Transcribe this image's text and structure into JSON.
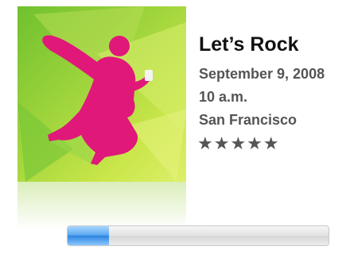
{
  "event": {
    "title": "Let’s Rock",
    "date": "September 9, 2008",
    "time": "10 a.m.",
    "location": "San Francisco",
    "rating_stars": "★★★★★",
    "rating": 5
  },
  "artwork": {
    "description_icon": "silhouette-dancer-with-music-player",
    "colors": {
      "background": "#8fcf3a",
      "figure": "#e0187a"
    }
  },
  "progress": {
    "fraction": 0.16,
    "color": "#4a9eeb"
  }
}
